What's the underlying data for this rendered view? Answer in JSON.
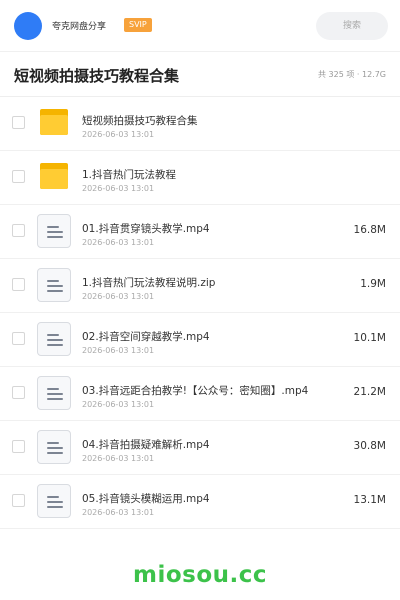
{
  "header": {
    "user_name": "夸克网盘分享",
    "badge": "SVIP",
    "search_placeholder": "搜索"
  },
  "folder": {
    "title": "短视频拍摄技巧教程合集",
    "meta": "共 325 项 · 12.7G"
  },
  "items": [
    {
      "type": "folder",
      "icon": "folder-icon",
      "name": "短视频拍摄技巧教程合集",
      "date": "2026-06-03 13:01",
      "size": ""
    },
    {
      "type": "folder",
      "icon": "folder-icon",
      "name": "1.抖音热门玩法教程",
      "date": "2026-06-03 13:01",
      "size": ""
    },
    {
      "type": "file",
      "icon": "file-icon",
      "name": "01.抖音贯穿镜头教学.mp4",
      "date": "2026-06-03 13:01",
      "size": "16.8M"
    },
    {
      "type": "file",
      "icon": "file-icon",
      "name": "1.抖音热门玩法教程说明.zip",
      "date": "2026-06-03 13:01",
      "size": "1.9M"
    },
    {
      "type": "file",
      "icon": "file-icon",
      "name": "02.抖音空间穿越教学.mp4",
      "date": "2026-06-03 13:01",
      "size": "10.1M"
    },
    {
      "type": "file",
      "icon": "file-icon",
      "name": "03.抖音远距合拍教学!【公众号：密知圈】.mp4",
      "date": "2026-06-03 13:01",
      "size": "21.2M"
    },
    {
      "type": "file",
      "icon": "file-icon",
      "name": "04.抖音拍摄疑难解析.mp4",
      "date": "2026-06-03 13:01",
      "size": "30.8M"
    },
    {
      "type": "file",
      "icon": "file-icon",
      "name": "05.抖音镜头模糊运用.mp4",
      "date": "2026-06-03 13:01",
      "size": "13.1M"
    }
  ],
  "watermark": "miosou.cc",
  "colors": {
    "avatar": "#2f7cf6",
    "badge": "#f7a23b",
    "folder": "#ffcc33",
    "watermark": "#3cc24a"
  }
}
